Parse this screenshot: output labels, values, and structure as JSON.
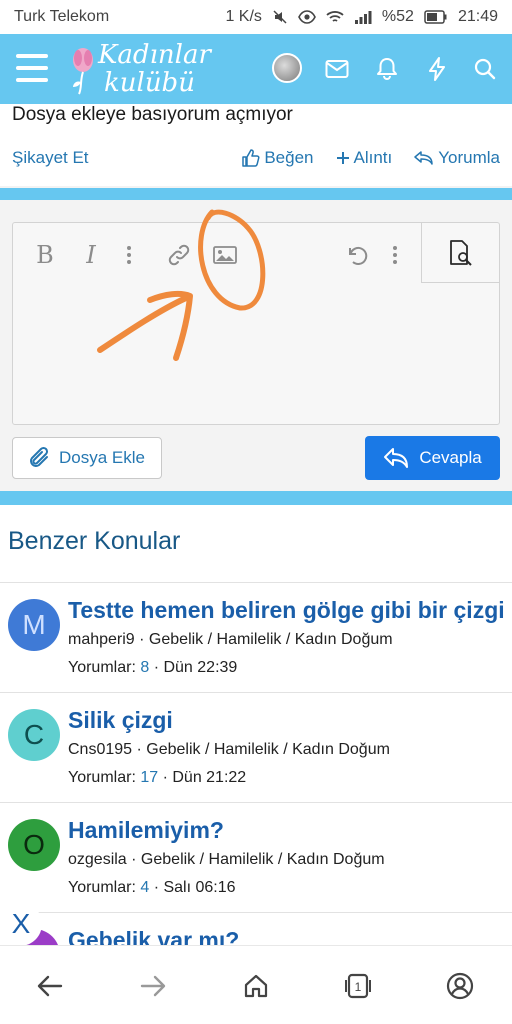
{
  "status": {
    "carrier": "Turk Telekom",
    "speed": "1 K/s",
    "battery": "%52",
    "time": "21:49"
  },
  "header": {
    "logo_line1": "Kadınlar",
    "logo_line2": "kulübü"
  },
  "post": {
    "text": "Dosya ekleye basıyorum açmıyor",
    "report": "Şikayet Et",
    "like": "Beğen",
    "quote": "Alıntı",
    "reply": "Yorumla"
  },
  "editor": {
    "bold": "B",
    "italic": "I",
    "attach_label": "Dosya Ekle",
    "reply_label": "Cevapla"
  },
  "related": {
    "title": "Benzer Konular",
    "threads": [
      {
        "letter": "M",
        "title": "Testte hemen beliren gölge gibi bir çizgi",
        "author": "mahperi9",
        "forum": "Gebelik / Hamilelik / Kadın Doğum",
        "replies_label": "Yorumlar:",
        "replies": "8",
        "date": "Dün 22:39"
      },
      {
        "letter": "C",
        "title": "Silik çizgi",
        "author": "Cns0195",
        "forum": "Gebelik / Hamilelik / Kadın Doğum",
        "replies_label": "Yorumlar:",
        "replies": "17",
        "date": "Dün 21:22"
      },
      {
        "letter": "O",
        "title": "Hamilemiyim?",
        "author": "ozgesila",
        "forum": "Gebelik / Hamilelik / Kadın Doğum",
        "replies_label": "Yorumlar:",
        "replies": "4",
        "date": "Salı 06:16"
      },
      {
        "title": "Gebelik var mı?"
      }
    ]
  },
  "close": {
    "label": "X"
  },
  "bottom_nav": {
    "tabs_count": "1"
  },
  "colors": {
    "header": "#66c7f0",
    "link": "#2577b1",
    "primary_button": "#1a79e6",
    "annotation": "#ef8a3d",
    "avatar_m": "#3f7ad6",
    "avatar_c": "#5fcfcf",
    "avatar_o": "#2e9e3e",
    "avatar_g": "#9b3cc7"
  },
  "icons": [
    "hamburger-icon",
    "envelope-icon",
    "bell-icon",
    "bolt-icon",
    "search-icon",
    "thumbs-up-icon",
    "plus-icon",
    "reply-icon",
    "undo-icon",
    "link-icon",
    "image-icon",
    "preview-icon",
    "paperclip-icon",
    "back-arrow-icon",
    "forward-arrow-icon",
    "home-icon",
    "tabs-icon",
    "account-icon"
  ]
}
